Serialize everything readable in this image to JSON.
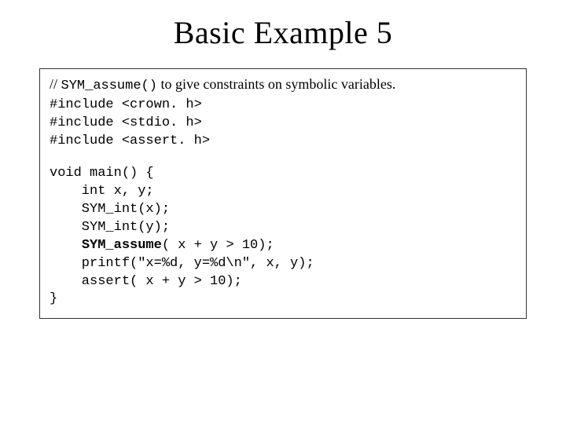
{
  "title": "Basic Example 5",
  "comment": {
    "prefix": "// ",
    "code": "SYM_assume()",
    "suffix": " to give constraints on symbolic variables."
  },
  "includes": "#include <crown. h>\n#include <stdio. h>\n#include <assert. h>",
  "body_pre": "void main() {\n    int x, y;\n    SYM_int(x);\n    SYM_int(y);\n    ",
  "body_bold": "SYM_assume",
  "body_post": "( x + y > 10);\n    printf(\"x=%d, y=%d\\n\", x, y);\n    assert( x + y > 10);\n}"
}
